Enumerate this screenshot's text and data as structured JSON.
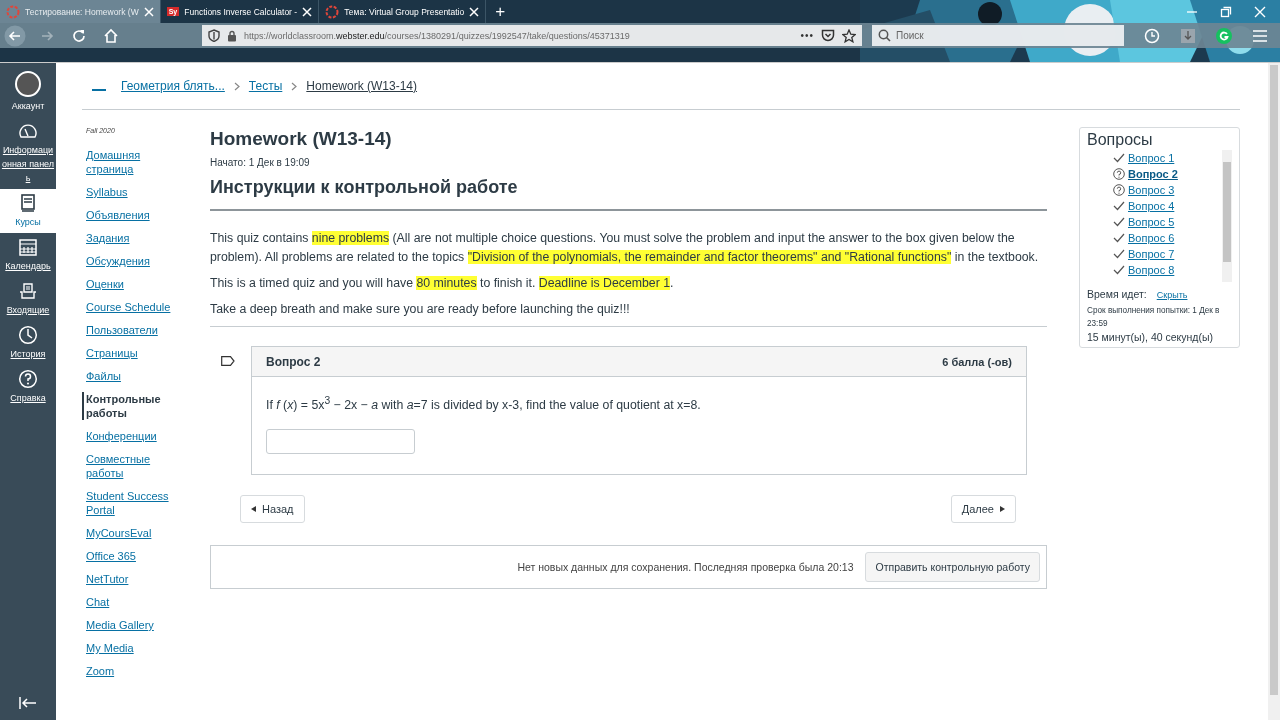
{
  "browser": {
    "tabs": [
      {
        "title": "Тестирование: Homework (W",
        "kind": "ring",
        "selected": true
      },
      {
        "title": "Functions Inverse Calculator - ",
        "kind": "badge",
        "badge": "Sy",
        "selected": false
      },
      {
        "title": "Тема: Virtual Group Presentatio",
        "kind": "ring",
        "selected": false
      }
    ],
    "new_tab": "+",
    "nav_buttons": [
      {
        "kind": "back",
        "disabled": false
      },
      {
        "kind": "forward",
        "disabled": true
      },
      {
        "kind": "reload",
        "disabled": false
      },
      {
        "kind": "home",
        "disabled": false
      }
    ],
    "url": {
      "prefix": "https://worldclassroom.",
      "domain": "webster.edu",
      "path": "/courses/1380291/quizzes/1992547/take/questions/45371319"
    },
    "page_actions": "•••",
    "search": {
      "placeholder": "Поиск"
    }
  },
  "global_nav": {
    "items": [
      {
        "label": "Аккаунт",
        "kind": "avatar",
        "selected": false
      },
      {
        "label": "Информационная панель",
        "kind": "dashboard",
        "selected": false
      },
      {
        "label": "Курсы",
        "kind": "courses",
        "selected": true
      },
      {
        "label": "Календарь",
        "kind": "calendar",
        "selected": false
      },
      {
        "label": "Входящие",
        "kind": "inbox",
        "selected": false
      },
      {
        "label": "История",
        "kind": "history",
        "selected": false
      },
      {
        "label": "Справка",
        "kind": "help",
        "selected": false
      }
    ]
  },
  "breadcrumbs": [
    "Геометрия блять...",
    "Тесты",
    "Homework (W13-14)"
  ],
  "course_nav": {
    "term": "Fall 2020",
    "items": [
      {
        "label": "Домашняя страница",
        "selected": false
      },
      {
        "label": "Syllabus",
        "selected": false
      },
      {
        "label": "Объявления",
        "selected": false
      },
      {
        "label": "Задания",
        "selected": false
      },
      {
        "label": "Обсуждения",
        "selected": false
      },
      {
        "label": "Оценки",
        "selected": false
      },
      {
        "label": "Course Schedule",
        "selected": false
      },
      {
        "label": "Пользователи",
        "selected": false
      },
      {
        "label": "Страницы",
        "selected": false
      },
      {
        "label": "Файлы",
        "selected": false
      },
      {
        "label": "Контрольные работы",
        "selected": true
      },
      {
        "label": "Конференции",
        "selected": false
      },
      {
        "label": "Совместные работы",
        "selected": false
      },
      {
        "label": "Student Success Portal",
        "selected": false
      },
      {
        "label": "MyCoursEval",
        "selected": false
      },
      {
        "label": "Office 365",
        "selected": false
      },
      {
        "label": "NetTutor",
        "selected": false
      },
      {
        "label": "Chat",
        "selected": false
      },
      {
        "label": "Media Gallery",
        "selected": false
      },
      {
        "label": "My Media",
        "selected": false
      },
      {
        "label": "Zoom",
        "selected": false
      }
    ]
  },
  "quiz": {
    "title": "Homework (W13-14)",
    "started": "Начато: 1 Дек в 19:09",
    "instructions_heading": "Инструкции к контрольной работе",
    "paragraphs": [
      {
        "segments": [
          {
            "text": "This quiz contains ",
            "highlighted": false
          },
          {
            "text": "nine problems",
            "highlighted": true
          },
          {
            "text": " (All are not multiple choice questions. You must solve the problem and input the answer to the box given below the problem). All problems are related to the topics ",
            "highlighted": false
          },
          {
            "text": "\"Division of the polynomials, the remainder and factor theorems\" and \"Rational functions\"",
            "highlighted": true
          },
          {
            "text": " in the textbook.",
            "highlighted": false
          }
        ]
      },
      {
        "segments": [
          {
            "text": "This is a timed quiz and you will have ",
            "highlighted": false
          },
          {
            "text": "80 minutes",
            "highlighted": true
          },
          {
            "text": " to finish it. ",
            "highlighted": false
          },
          {
            "text": "Deadline is December 1",
            "highlighted": true
          },
          {
            "text": ".",
            "highlighted": false
          }
        ]
      },
      {
        "segments": [
          {
            "text": "Take a deep breath and make sure you are ready before launching the quiz!!!",
            "highlighted": false
          }
        ]
      }
    ],
    "question": {
      "title": "Вопрос 2",
      "points": "6 балла (-ов)",
      "text": "If *f* (*x*) = 5x$^{3}$ − 2x − *a* with *a*=7 is divided by x-3, find the value of quotient at x=8."
    },
    "prev_button": "Назад",
    "next_button": "Далее",
    "footer": {
      "status": "Нет новых данных для сохранения. Последняя проверка была 20:13",
      "submit": "Отправить контрольную работу"
    }
  },
  "sidebar": {
    "title": "Вопросы",
    "questions": [
      {
        "label": "Вопрос 1",
        "kind": "answered",
        "selected": false
      },
      {
        "label": "Вопрос 2",
        "kind": "unanswered",
        "selected": true
      },
      {
        "label": "Вопрос 3",
        "kind": "unanswered",
        "selected": false
      },
      {
        "label": "Вопрос 4",
        "kind": "answered",
        "selected": false
      },
      {
        "label": "Вопрос 5",
        "kind": "answered",
        "selected": false
      },
      {
        "label": "Вопрос 6",
        "kind": "answered",
        "selected": false
      },
      {
        "label": "Вопрос 7",
        "kind": "answered",
        "selected": false
      },
      {
        "label": "Вопрос 8",
        "kind": "answered",
        "selected": false
      }
    ],
    "timer_label": "Время идет:",
    "hide_link": "Скрыть",
    "due": "Срок выполнения попытки: 1 Дек в 23:59",
    "elapsed": "15 минут(ы), 40 секунд(ы)"
  }
}
